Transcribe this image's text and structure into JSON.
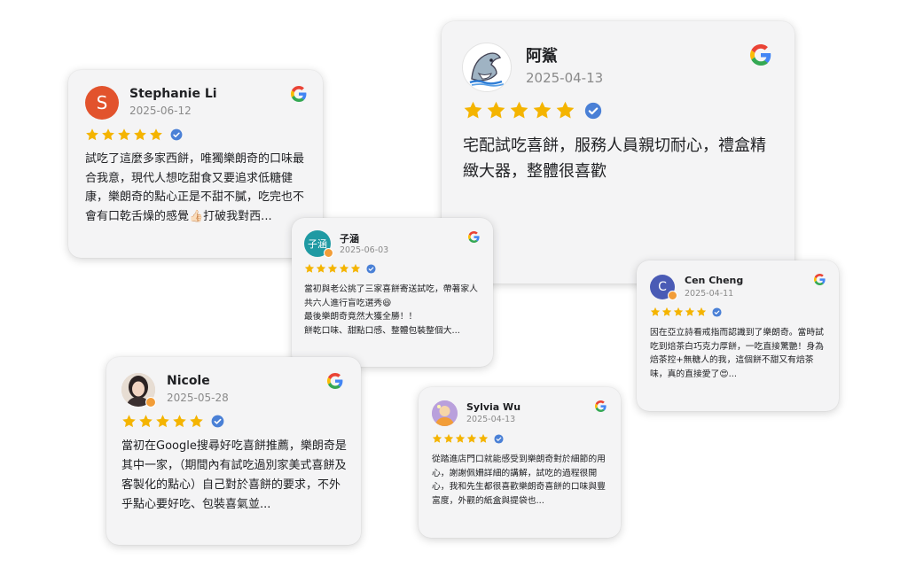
{
  "reviews": [
    {
      "name": "Stephanie Li",
      "date": "2025-06-12",
      "avatar_letter": "S",
      "avatar_color": "#e2532d",
      "text": "試吃了這麼多家西餅，唯獨樂朗奇的口味最合我意，現代人想吃甜食又要追求低糖健康，樂朗奇的點心正是不甜不膩，吃完也不會有口乾舌燥的感覺👍🏻打破我對西..."
    },
    {
      "name": "阿鯊",
      "date": "2025-04-13",
      "avatar_icon": "shark-icon",
      "text": "宅配試吃喜餅，服務人員親切耐心，禮盒精緻大器，整體很喜歡"
    },
    {
      "name": "子涵",
      "date": "2025-06-03",
      "avatar_letter": "子涵",
      "avatar_color": "#1f9aa3",
      "text": "當初與老公挑了三家喜餅寄送試吃，帶著家人共六人進行盲吃選秀😆\n最後樂朗奇竟然大獲全勝！！\n餅乾口味、甜點口感、整體包裝整個大..."
    },
    {
      "name": "Cen Cheng",
      "date": "2025-04-11",
      "avatar_letter": "C",
      "avatar_color": "#4a5bb5",
      "text": "因在亞立詩看戒指而認識到了樂朗奇。當時試吃到焙茶白巧克力厚餅，一吃直接驚艷！身為焙茶控+無糖人的我，這個餅不甜又有焙茶味，真的直接愛了😍..."
    },
    {
      "name": "Nicole",
      "date": "2025-05-28",
      "avatar_icon": "profile-photo",
      "text": "當初在Google搜尋好吃喜餅推薦，樂朗奇是其中一家，（期間內有試吃過別家美式喜餅及客製化的點心）自己對於喜餅的要求，不外乎點心要好吃、包裝喜氣並..."
    },
    {
      "name": "Sylvia Wu",
      "date": "2025-04-13",
      "avatar_icon": "profile-photo",
      "text": "從踏進店門口就能感受到樂朗奇對於細節的用心，謝謝佩姍詳細的講解，試吃的過程很開心，我和先生都很喜歡樂朗奇喜餅的口味與豐富度，外觀的紙盒與提袋也..."
    }
  ],
  "rating": 5,
  "colors": {
    "star": "#f4b400",
    "verified": "#4a80d6",
    "card_bg": "#f4f4f5"
  },
  "icons": {
    "google": "google-logo-icon",
    "verified": "verified-badge-icon",
    "star": "star-icon"
  }
}
